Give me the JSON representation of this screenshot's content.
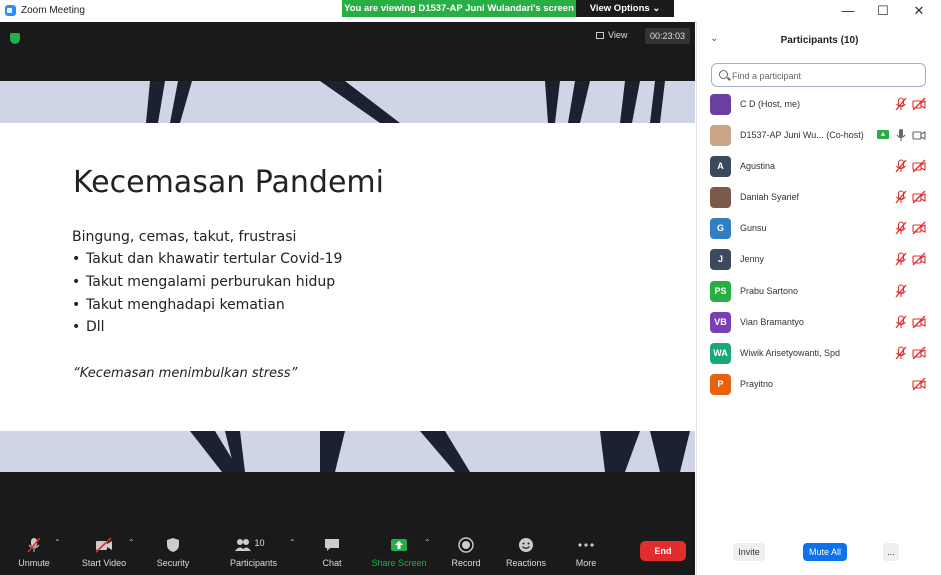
{
  "window": {
    "title": "Zoom Meeting",
    "share_banner": "You are viewing D1537-AP Juni Wulandari's screen",
    "view_options": "View Options",
    "controls": {
      "minimize": "—",
      "maximize": "☐",
      "close": "✕"
    }
  },
  "meeting": {
    "view_label": "View",
    "timer": "00:23:03"
  },
  "slide": {
    "title": "Kecemasan Pandemi",
    "intro": "Bingung, cemas, takut, frustrasi",
    "bullets": [
      "Takut dan khawatir tertular Covid-19",
      "Takut mengalami perburukan hidup",
      "Takut menghadapi kematian",
      "Dll"
    ],
    "quote": "“Kecemasan menimbulkan stress”"
  },
  "toolbar": {
    "unmute": "Unmute",
    "start_video": "Start Video",
    "security": "Security",
    "participants": "Participants",
    "participants_count": "10",
    "chat": "Chat",
    "share_screen": "Share Screen",
    "record": "Record",
    "reactions": "Reactions",
    "more": "More",
    "end": "End"
  },
  "panel": {
    "title": "Participants (10)",
    "search_placeholder": "Find a participant",
    "participants": [
      {
        "initials": "",
        "name": "C D (Host, me)",
        "avatar_color": "#6b3fa0",
        "mic": "muted",
        "video": "off"
      },
      {
        "initials": "",
        "name": "D1537-AP Juni Wu... (Co-host)",
        "avatar_color": "#c9a68a",
        "mic": "on",
        "video": "on",
        "sharing": true
      },
      {
        "initials": "A",
        "name": "Agustina",
        "avatar_color": "#3c4a5e",
        "mic": "muted",
        "video": "off"
      },
      {
        "initials": "",
        "name": "Daniah Syarief",
        "avatar_color": "#7a5a4a",
        "mic": "muted",
        "video": "off"
      },
      {
        "initials": "G",
        "name": "Gunsu",
        "avatar_color": "#2f7fc1",
        "mic": "muted",
        "video": "off"
      },
      {
        "initials": "J",
        "name": "Jenny",
        "avatar_color": "#3c4a5e",
        "mic": "muted",
        "video": "off"
      },
      {
        "initials": "PS",
        "name": "Prabu Sartono",
        "avatar_color": "#27ae45",
        "mic": "muted",
        "video": "none"
      },
      {
        "initials": "VB",
        "name": "Vian Bramantyo",
        "avatar_color": "#7b3fb5",
        "mic": "muted",
        "video": "off"
      },
      {
        "initials": "WA",
        "name": "Wiwik Arisetyowanti, Spd",
        "avatar_color": "#19a974",
        "mic": "muted",
        "video": "off"
      },
      {
        "initials": "P",
        "name": "Prayitno",
        "avatar_color": "#e8620c",
        "mic": "none",
        "video": "off"
      }
    ],
    "invite": "Invite",
    "mute_all": "Mute All",
    "more": "..."
  },
  "colors": {
    "share_green": "#27ae45",
    "end_red": "#e02d2d",
    "muted_red": "#e02d2d",
    "mute_all_blue": "#0e72ed",
    "slide_band": "#cfd4e6"
  }
}
